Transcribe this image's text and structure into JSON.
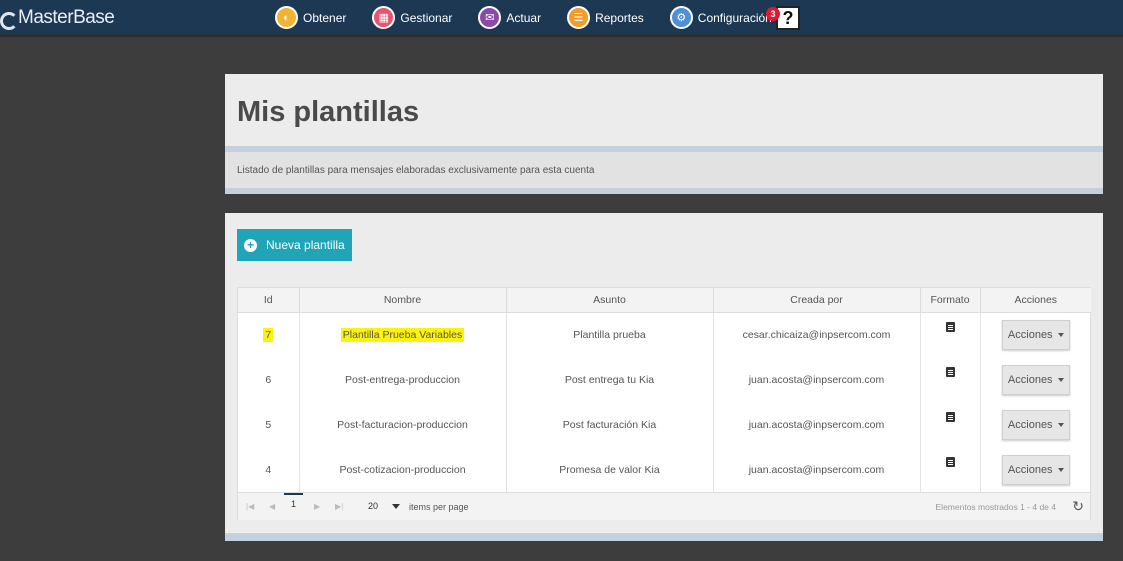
{
  "brand": {
    "name": "MasterBase"
  },
  "nav": [
    {
      "label": "Obtener",
      "icon": "obtener-icon"
    },
    {
      "label": "Gestionar",
      "icon": "gestionar-icon"
    },
    {
      "label": "Actuar",
      "icon": "actuar-icon"
    },
    {
      "label": "Reportes",
      "icon": "reportes-icon"
    },
    {
      "label": "Configuración",
      "icon": "config-icon"
    }
  ],
  "help": {
    "badge": "3",
    "glyph": "?"
  },
  "header": {
    "title": "Mis plantillas",
    "subtitle": "Listado de plantillas para mensajes elaboradas exclusivamente para esta cuenta"
  },
  "toolbar": {
    "new_label": "Nueva plantilla"
  },
  "table": {
    "columns": [
      "Id",
      "Nombre",
      "Asunto",
      "Creada por",
      "Formato",
      "Acciones"
    ],
    "rows": [
      {
        "id": "7",
        "nombre": "Plantilla Prueba Variables",
        "asunto": "Plantilla prueba",
        "creada_por": "cesar.chicaiza@inpsercom.com",
        "acciones": "Acciones",
        "highlighted": true
      },
      {
        "id": "6",
        "nombre": "Post-entrega-produccion",
        "asunto": "Post entrega tu Kia",
        "creada_por": "juan.acosta@inpsercom.com",
        "acciones": "Acciones"
      },
      {
        "id": "5",
        "nombre": "Post-facturacion-produccion",
        "asunto": "Post facturación Kia",
        "creada_por": "juan.acosta@inpsercom.com",
        "acciones": "Acciones"
      },
      {
        "id": "4",
        "nombre": "Post-cotizacion-produccion",
        "asunto": "Promesa de valor Kia",
        "creada_por": "juan.acosta@inpsercom.com",
        "acciones": "Acciones"
      }
    ]
  },
  "pager": {
    "current_page": "1",
    "page_size": "20",
    "items_label": "items per page",
    "info": "Elementos mostrados 1 - 4 de 4"
  },
  "colors": {
    "topbar": "#1d3853",
    "accent": "#1fa4b8",
    "highlight": "#fbf20f",
    "background": "#3d3d3d"
  }
}
